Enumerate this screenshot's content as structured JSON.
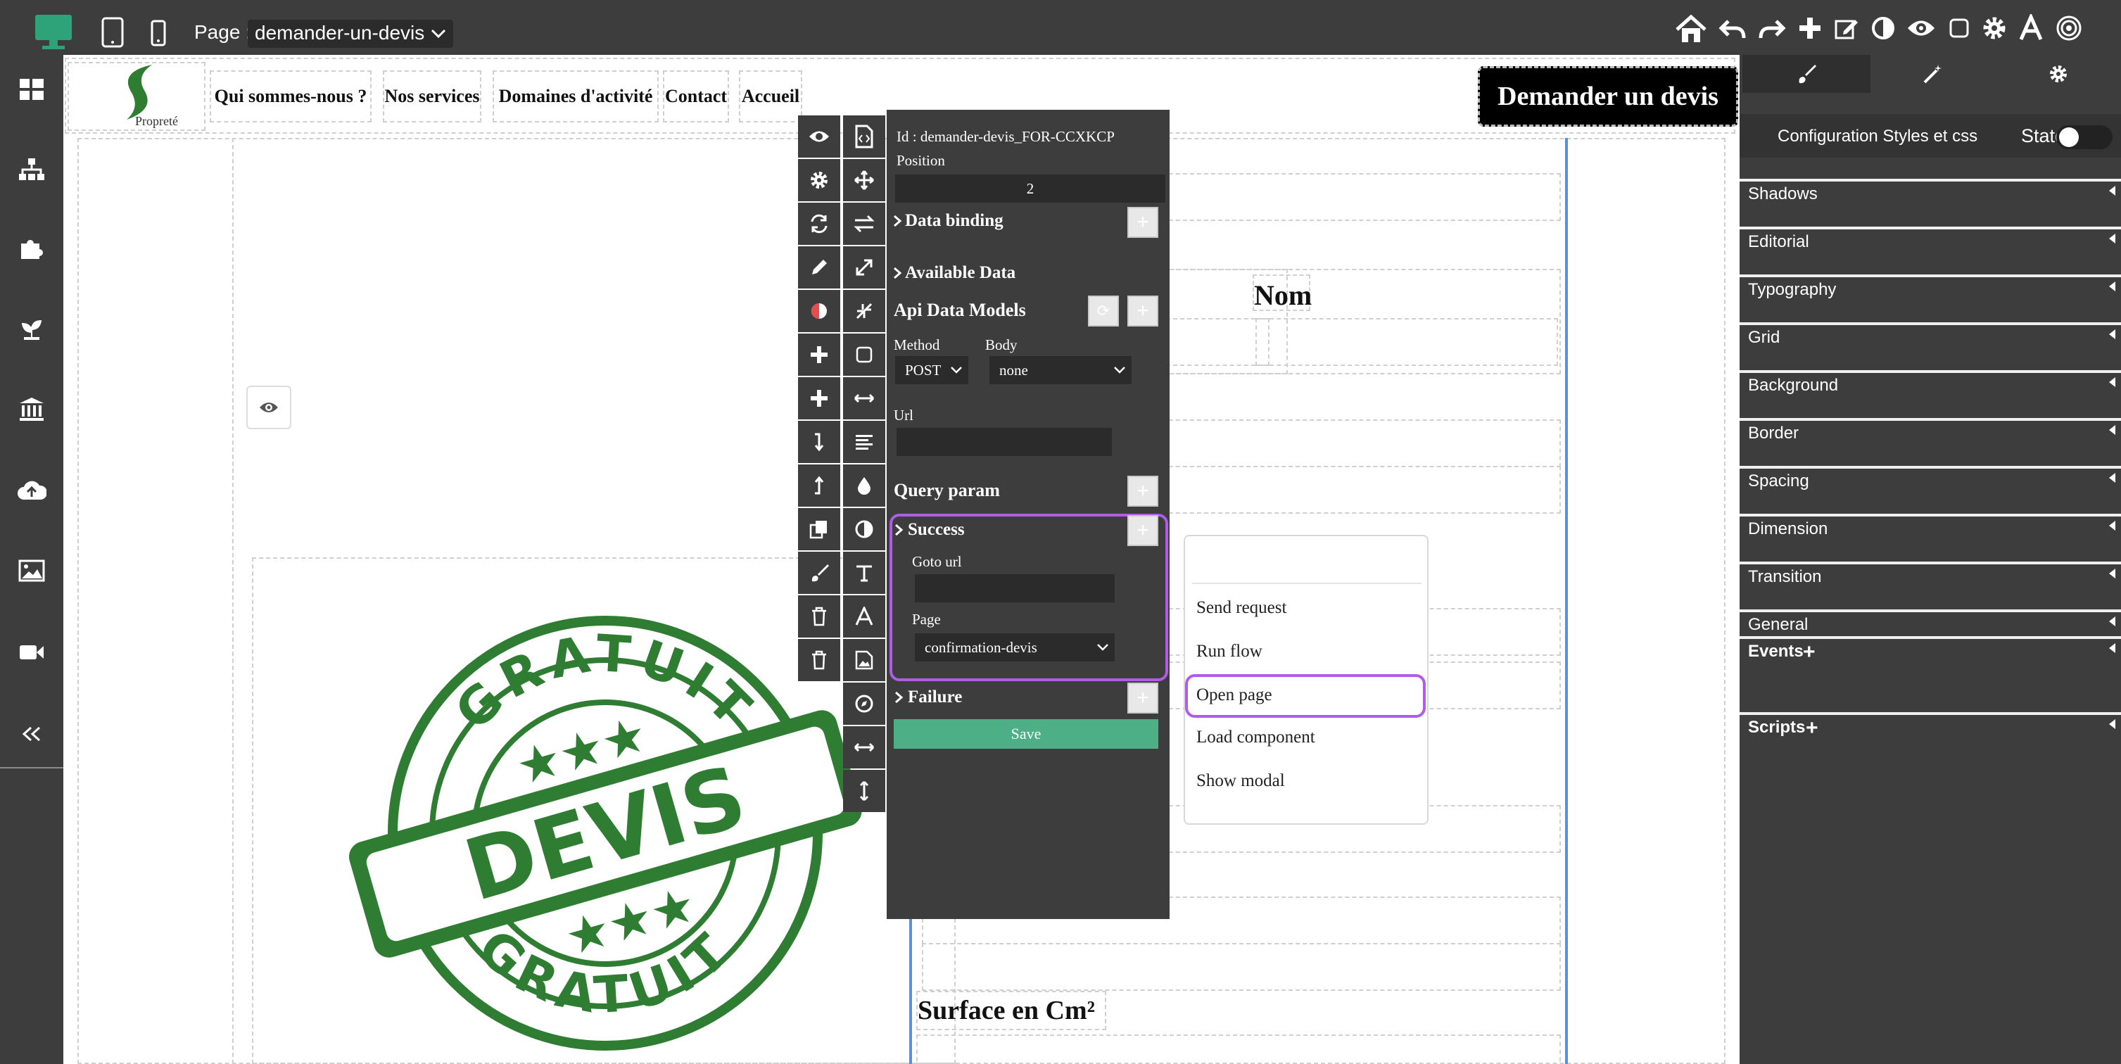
{
  "topbar": {
    "page_label": "Page :",
    "page_value": "demander-un-devis"
  },
  "colors": {
    "accent_green": "#2ea37a",
    "highlight_purple": "#b05ce8",
    "stamp_green": "#2e7d32",
    "save_green": "#4caf86"
  },
  "toolbar_icons": [
    "home-icon",
    "undo-icon",
    "redo-icon",
    "plus-icon",
    "edit-icon",
    "contrast-icon",
    "eye-icon",
    "square-icon",
    "gear-icon",
    "font-icon",
    "target-icon"
  ],
  "sidebar_icons": [
    "dashboard-icon",
    "sitemap-icon",
    "puzzle-icon",
    "plant-icon",
    "bank-icon",
    "cloud-upload-icon",
    "image-icon",
    "video-icon",
    "collapse-icon"
  ],
  "site": {
    "logo_text": "Propreté",
    "nav": [
      "Qui sommes-nous ?",
      "Nos services",
      "Domaines d'activité",
      "Contact",
      "Accueil"
    ],
    "cta": "Demander un devis",
    "field_nom": "Nom",
    "field_surface": "Surface en Cm²",
    "stamp": {
      "top": "GRATUIT",
      "middle": "DEVIS",
      "bottom": "GRATUIT"
    }
  },
  "props": {
    "id_text": "Id : demander-devis_FOR-CCXKCP",
    "position_label": "Position",
    "position_value": "2",
    "data_binding": "Data binding",
    "available_data": "Available Data",
    "api_models": "Api Data Models",
    "method_label": "Method",
    "method_value": "POST",
    "body_label": "Body",
    "body_value": "none",
    "url_label": "Url",
    "query_param": "Query param",
    "success": "Success",
    "goto_url": "Goto url",
    "page_label": "Page",
    "page_value": "confirmation-devis",
    "failure": "Failure",
    "save": "Save"
  },
  "action_menu": {
    "items": [
      "Send request",
      "Run flow",
      "Open page",
      "Load component",
      "Show modal"
    ],
    "selected": "Open page"
  },
  "right_panel": {
    "config_label": "Configuration Styles et css",
    "state_label": "State",
    "sections": [
      "Shadows",
      "Editorial",
      "Typography",
      "Grid",
      "Background",
      "Border",
      "Spacing",
      "Dimension",
      "Transition",
      "General"
    ],
    "events": "Events",
    "scripts": "Scripts"
  }
}
